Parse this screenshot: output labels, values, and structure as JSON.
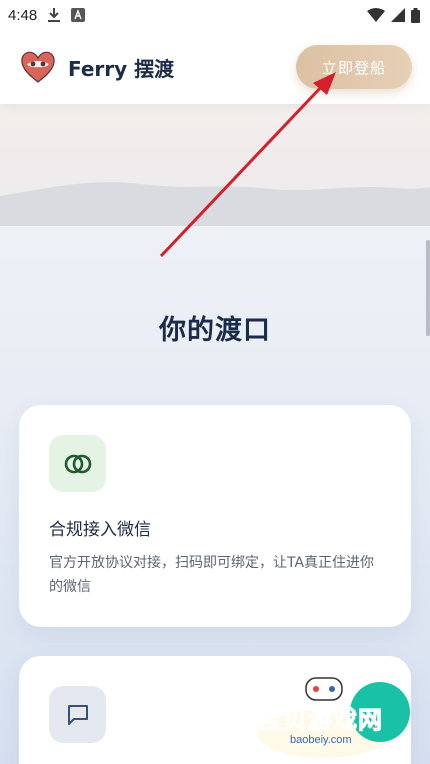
{
  "status_bar": {
    "time": "4:48",
    "icons": [
      "download-icon",
      "a-notification-icon",
      "wifi-icon",
      "signal-icon",
      "battery-icon"
    ]
  },
  "header": {
    "app_name": "Ferry 摆渡",
    "cta_label": "立即登船"
  },
  "main": {
    "section_title": "你的渡口",
    "cards": [
      {
        "icon": "rings-icon",
        "title": "合规接入微信",
        "description": "官方开放协议对接，扫码即可绑定，让TA真正住进你的微信"
      },
      {
        "icon": "chat-bubble-icon",
        "title": "",
        "description": ""
      }
    ]
  },
  "watermark": {
    "text": "宝贝游戏网",
    "url": "baobeiy.com"
  },
  "colors": {
    "navy": "#1c2b4a",
    "gold_button": "#dcc1a3",
    "annotation_red": "#d3202b",
    "card_icon_green_bg": "#e4f3e3"
  }
}
